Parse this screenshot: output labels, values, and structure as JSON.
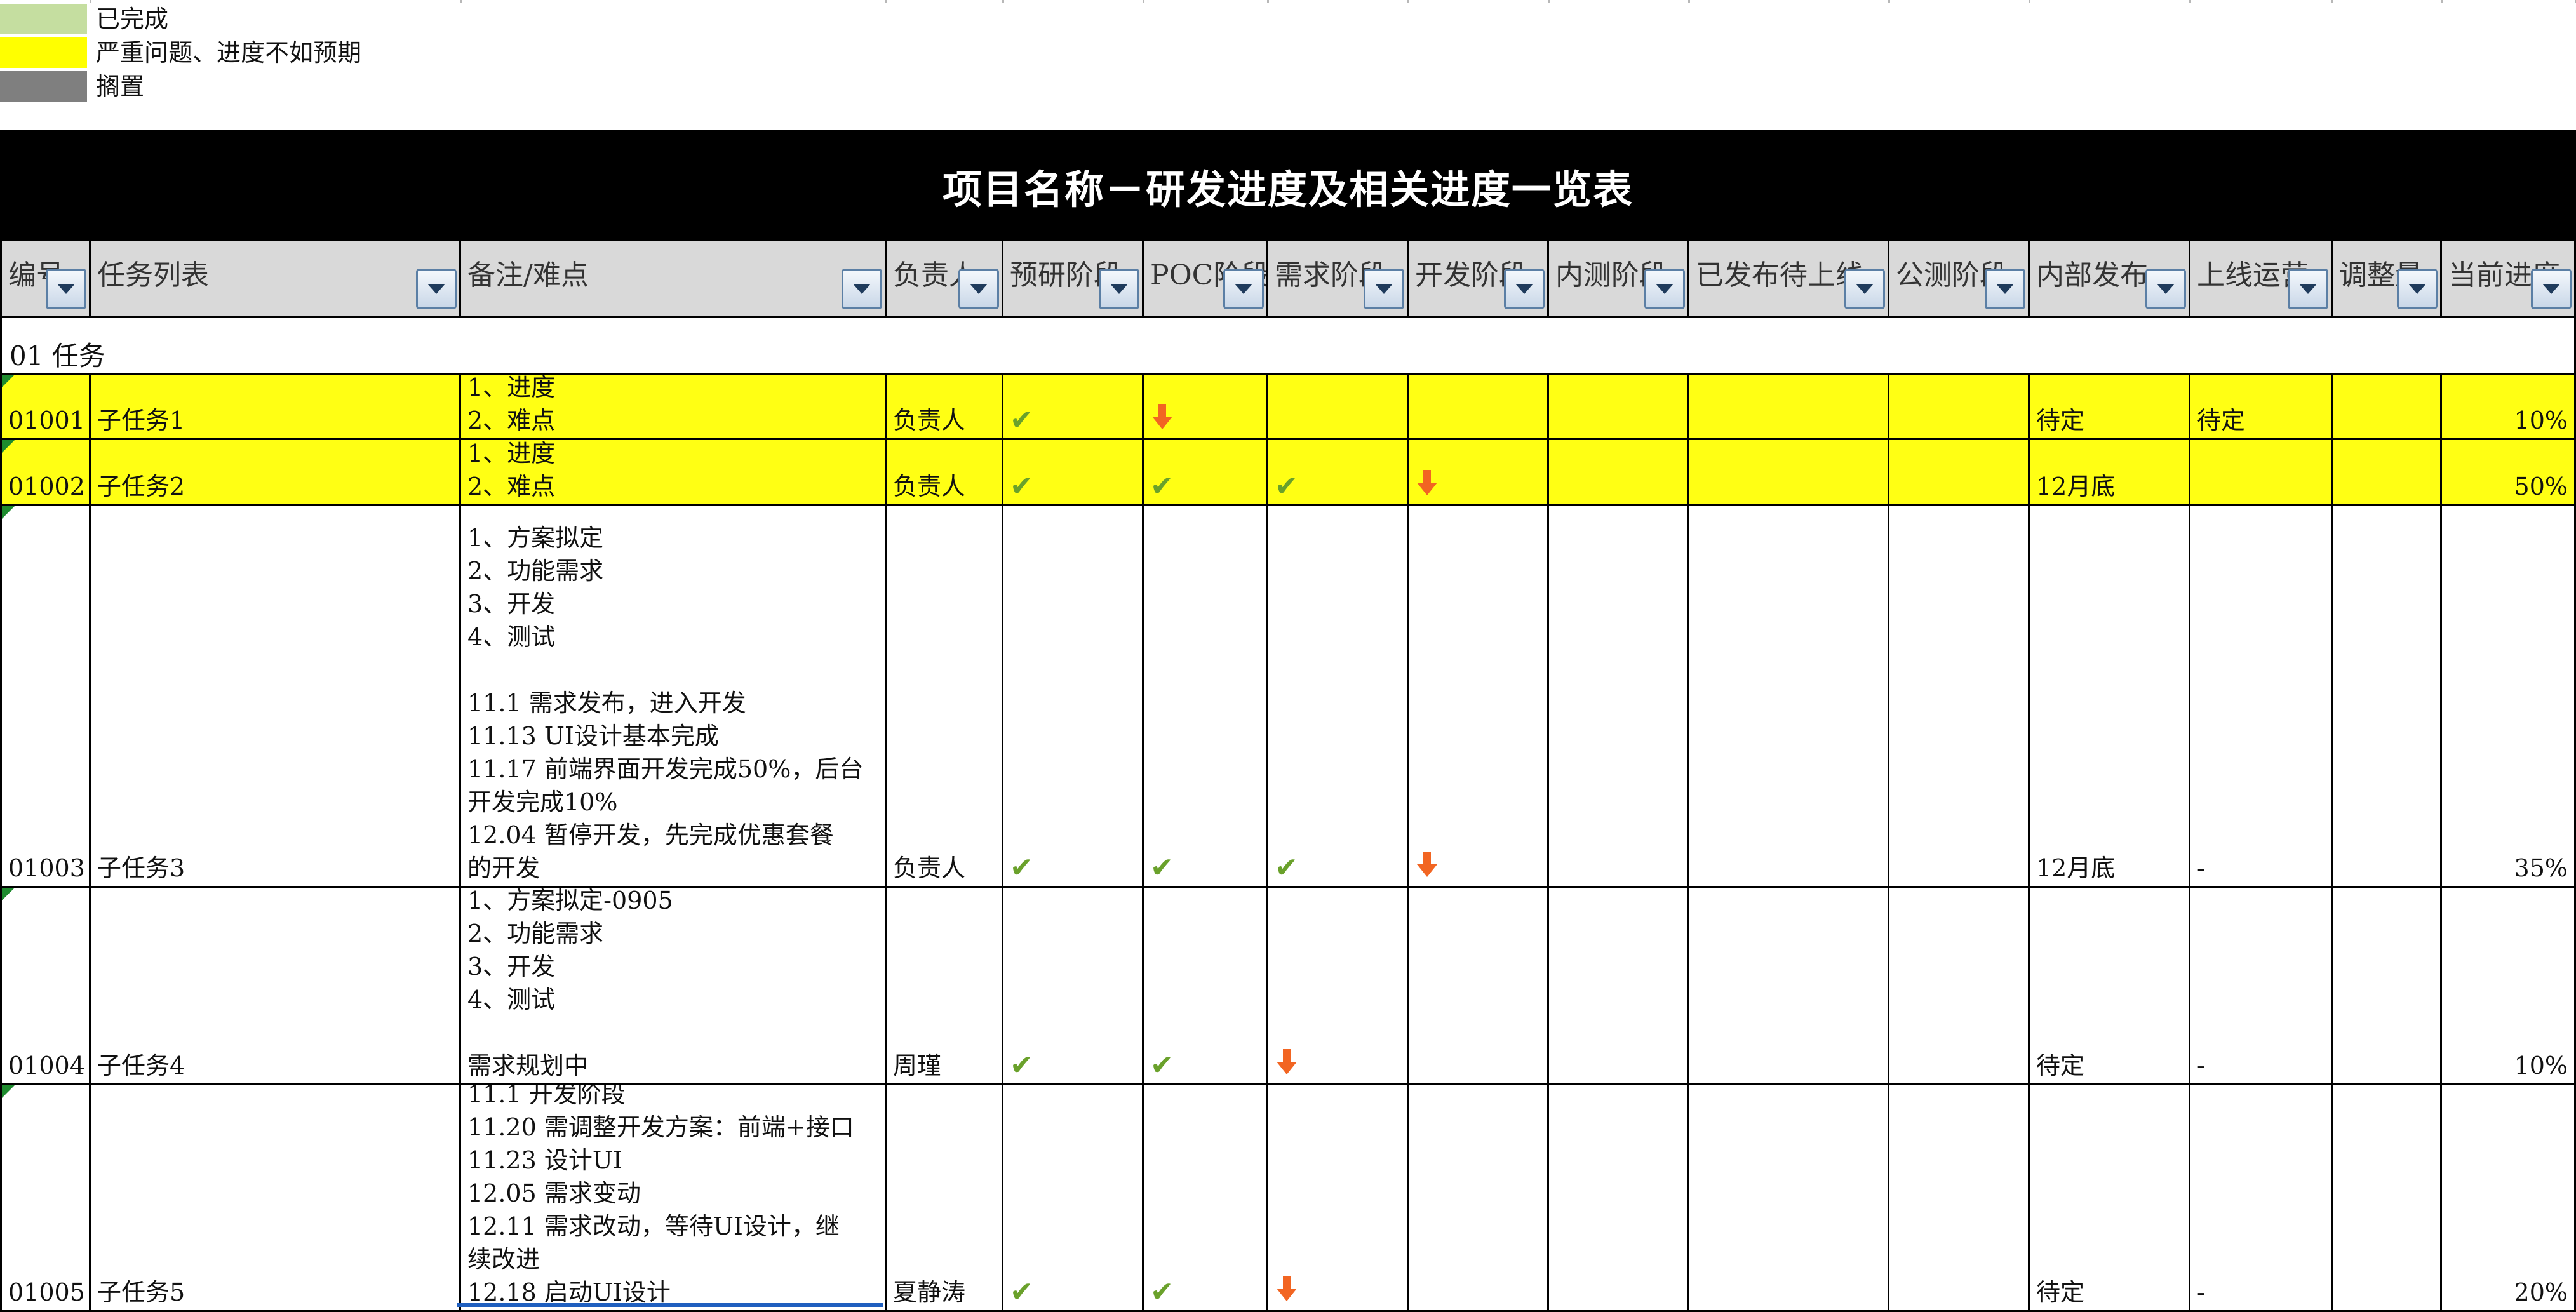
{
  "legend": [
    {
      "color": "#c5dea0",
      "label": "已完成"
    },
    {
      "color": "#ffff00",
      "label": "严重问题、进度不如预期"
    },
    {
      "color": "#7f7f7f",
      "label": "搁置"
    }
  ],
  "title": "项目名称－研发进度及相关进度一览表",
  "columns": [
    {
      "label": "编号"
    },
    {
      "label": "任务列表"
    },
    {
      "label": "备注/难点"
    },
    {
      "label": "负责人"
    },
    {
      "label": "预研阶段"
    },
    {
      "label": "POC阶段"
    },
    {
      "label": "需求阶段"
    },
    {
      "label": "开发阶段"
    },
    {
      "label": "内测阶段"
    },
    {
      "label": "已发布待上线"
    },
    {
      "label": "公测阶段"
    },
    {
      "label": "内部发布"
    },
    {
      "label": "上线运营"
    },
    {
      "label": "调整量"
    },
    {
      "label": "当前进度"
    }
  ],
  "section": "01 任务",
  "status_icons": {
    "done": "check-icon",
    "issue": "down-arrow-icon",
    "check_color": "#6aa12b",
    "arrow_color": "#f26522"
  },
  "rows": [
    {
      "id": "01001",
      "task": "子任务1",
      "notes": "1、进度\n2、难点",
      "owner": "负责人",
      "stages": [
        "done",
        "issue",
        "",
        "",
        "",
        "",
        ""
      ],
      "internal_release": "待定",
      "online": "待定",
      "adjust": "",
      "progress": "10%",
      "highlight": "yellow"
    },
    {
      "id": "01002",
      "task": "子任务2",
      "notes": "1、进度\n2、难点",
      "owner": "负责人",
      "stages": [
        "done",
        "done",
        "done",
        "issue",
        "",
        "",
        ""
      ],
      "internal_release": "12月底",
      "online": "",
      "adjust": "",
      "progress": "50%",
      "highlight": "yellow"
    },
    {
      "id": "01003",
      "task": "子任务3",
      "notes": "1、方案拟定\n2、功能需求\n3、开发\n4、测试\n\n11.1 需求发布，进入开发\n11.13 UI设计基本完成\n11.17 前端界面开发完成50%，后台\n开发完成10%\n12.04 暂停开发，先完成优惠套餐\n的开发",
      "owner": "负责人",
      "stages": [
        "done",
        "done",
        "done",
        "issue",
        "",
        "",
        ""
      ],
      "internal_release": "12月底",
      "online": "-",
      "adjust": "",
      "progress": "35%",
      "highlight": ""
    },
    {
      "id": "01004",
      "task": "子任务4",
      "notes": "1、方案拟定-0905\n2、功能需求\n3、开发\n4、测试\n\n需求规划中",
      "owner": "周瑾",
      "stages": [
        "done",
        "done",
        "issue",
        "",
        "",
        "",
        ""
      ],
      "internal_release": "待定",
      "online": "-",
      "adjust": "",
      "progress": "10%",
      "highlight": ""
    },
    {
      "id": "01005",
      "task": "子任务5",
      "notes": "11.1 开发阶段\n11.20 需调整开发方案：前端+接口\n11.23 设计UI\n12.05 需求变动\n12.11 需求改动，等待UI设计，继\n续改进\n12.18 启动UI设计",
      "owner": "夏静涛",
      "stages": [
        "done",
        "done",
        "issue",
        "",
        "",
        "",
        ""
      ],
      "internal_release": "待定",
      "online": "-",
      "adjust": "",
      "progress": "20%",
      "highlight": ""
    }
  ]
}
